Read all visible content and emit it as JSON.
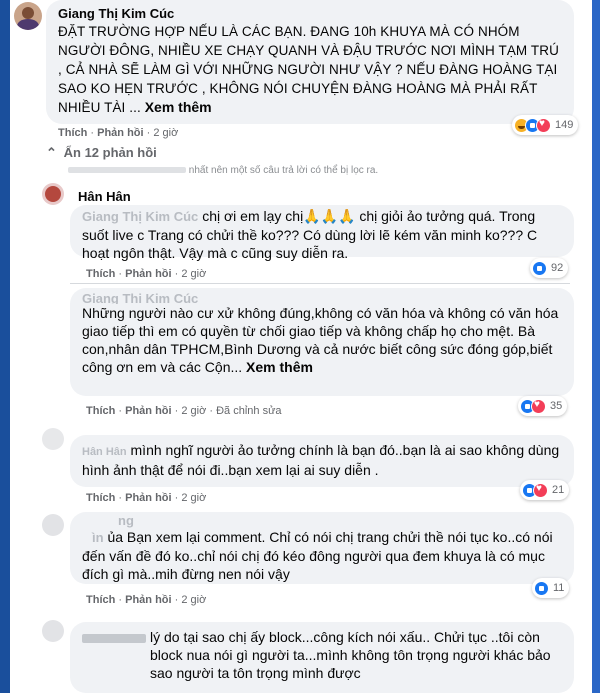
{
  "comments": [
    {
      "author": "Giang Thị Kim Cúc",
      "text": "ĐẶT TRƯỜNG HỢP NẾU LÀ CÁC BẠN. ĐANG 10h KHUYA MÀ CÓ NHÓM NGƯỜI ĐÔNG, NHIỀU XE CHẠY QUANH VÀ ĐẬU TRƯỚC NƠI MÌNH TẠM TRÚ , CẢ NHÀ SẼ LÀM GÌ VỚI NHỮNG NGƯỜI NHƯ VẬY ? NẾU ĐÀNG HOÀNG TẠI SAO KO HẸN TRƯỚC , KHÔNG NÓI CHUYỆN ĐÀNG HOÀNG MÀ PHẢI RẤT NHIỀU TÀI ...",
      "see_more": "Xem thêm",
      "like": "Thích",
      "reply": "Phản hồi",
      "time": "2 giờ",
      "reaction_count": "149"
    },
    {
      "author": "Hân Hân",
      "mention": "Giang Thị Kim Cúc",
      "text": "chị ơi em lạy chị🙏🙏🙏 chị giỏi ảo tưởng quá. Trong suốt live c Trang có chửi thề ko??? Có dùng lời lẽ kém văn minh ko??? C hoạt ngôn thật. Vậy mà c cũng suy diễn ra.",
      "like": "Thích",
      "reply": "Phản hồi",
      "time": "2 giờ",
      "reaction_count": "92"
    },
    {
      "author": "Giang Thị Kim Cúc",
      "text": "Những người nào cư xử không đúng,không có văn hóa và không có văn hóa giao tiếp thì em có quyền từ chối giao tiếp và không chấp họ cho mệt. Bà con,nhân dân TPHCM,Bình Dương và cả nước biết công sức đóng góp,biết công ơn em và các Cộn...",
      "see_more": "Xem thêm",
      "like": "Thích",
      "reply": "Phản hồi",
      "time": "2 giờ",
      "edited": "Đã chỉnh sửa",
      "reaction_count": "35"
    },
    {
      "author": "Hân Hân",
      "text": "mình nghĩ người ảo tưởng chính là bạn đó..bạn là ai sao không dùng hình ảnh thật để nói đi..bạn xem lại ai suy diễn .",
      "like": "Thích",
      "reply": "Phản hồi",
      "time": "2 giờ",
      "reaction_count": "21"
    },
    {
      "author": "ng",
      "text_prefix": "ìn",
      "text": "ủa Bạn xem lại comment. Chỉ có nói chị trang chửi thề nói tục ko..có nói đến vấn đề đó ko..chỉ nói chị đó kéo đông người qua đem khuya là có mục đích gì mà..mih đừng nen nói vậy",
      "like": "Thích",
      "reply": "Phản hồi",
      "time": "2 giờ",
      "reaction_count": "11"
    },
    {
      "author": "",
      "text": "lý do tại sao chị ấy block...công kích nói xấu.. Chửi tục ..tôi còn block nua nói gì người ta...mình không tôn trọng người khác bảo sao người ta tôn trọng mình được",
      "like": "Thích",
      "reply": "Phản hồi",
      "time": "2 giờ"
    }
  ],
  "hidden_replies": "Ẩn 12 phản hồi",
  "filter_notice": "nhất nên một số câu trả lời có thể bị lọc ra.",
  "colors": {
    "like": "#1877f2",
    "haha": "#f7b125",
    "love": "#f33e58",
    "bubble": "#f0f2f5",
    "frame": "#1a4f9c"
  }
}
